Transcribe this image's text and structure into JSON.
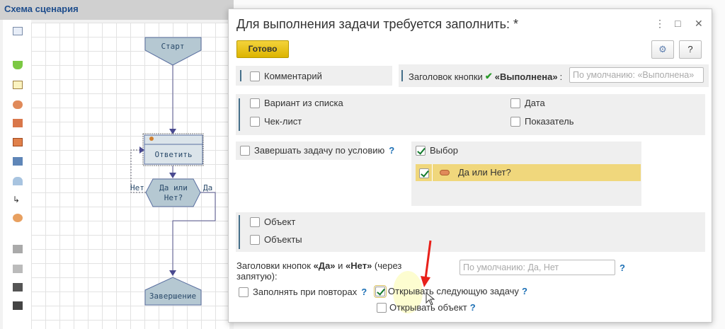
{
  "left_panel": {
    "title": "Схема сценария",
    "diagram": {
      "start": "Старт",
      "task": "Ответить",
      "decision_line1": "Да или",
      "decision_line2": "Нет?",
      "no_label": "Нет",
      "yes_label": "Да",
      "end": "Завершение"
    }
  },
  "dialog": {
    "title": "Для выполнения задачи требуется заполнить: *",
    "more_icon": "⋮",
    "maximize_icon": "□",
    "close_icon": "✕",
    "done_button": "Готово",
    "help_button": "?",
    "comment": {
      "label": "Комментарий",
      "checked": false
    },
    "button_caption": {
      "label": "Заголовок кнопки",
      "bold": "«Выполнена»",
      "colon": ":",
      "placeholder": "По умолчанию: «Выполнена»"
    },
    "options": [
      {
        "label": "Вариант из списка",
        "checked": false
      },
      {
        "label": "Чек-лист",
        "checked": false
      },
      {
        "label": "Дата",
        "checked": false
      },
      {
        "label": "Показатель",
        "checked": false
      }
    ],
    "finish_by_condition": {
      "label": "Завершать задачу по условию",
      "checked": false,
      "help": "?"
    },
    "choice": {
      "label": "Выбор",
      "checked": true,
      "items": [
        {
          "label": "Да или Нет?",
          "checked": true
        }
      ]
    },
    "objects": [
      {
        "label": "Объект",
        "checked": false
      },
      {
        "label": "Объекты",
        "checked": false
      }
    ],
    "yes_no_captions": {
      "text1": "Заголовки кнопок ",
      "bold1": "«Да»",
      "text2": " и ",
      "bold2": "«Нет»",
      "text3": " (через",
      "line2": "запятую):",
      "placeholder": "По умолчанию: Да, Нет",
      "help": "?"
    },
    "fill_on_repeat": {
      "label": "Заполнять при повторах",
      "checked": false,
      "help": "?"
    },
    "open_next_task": {
      "label": "Открывать следующую задачу",
      "checked": true,
      "help": "?"
    },
    "open_object": {
      "label": "Открывать объект",
      "checked": false,
      "help": "?"
    }
  },
  "colors": {
    "accent": "#f4d33b",
    "selected_row": "#f0d77c",
    "diagram_fill": "#b5c8d2"
  }
}
